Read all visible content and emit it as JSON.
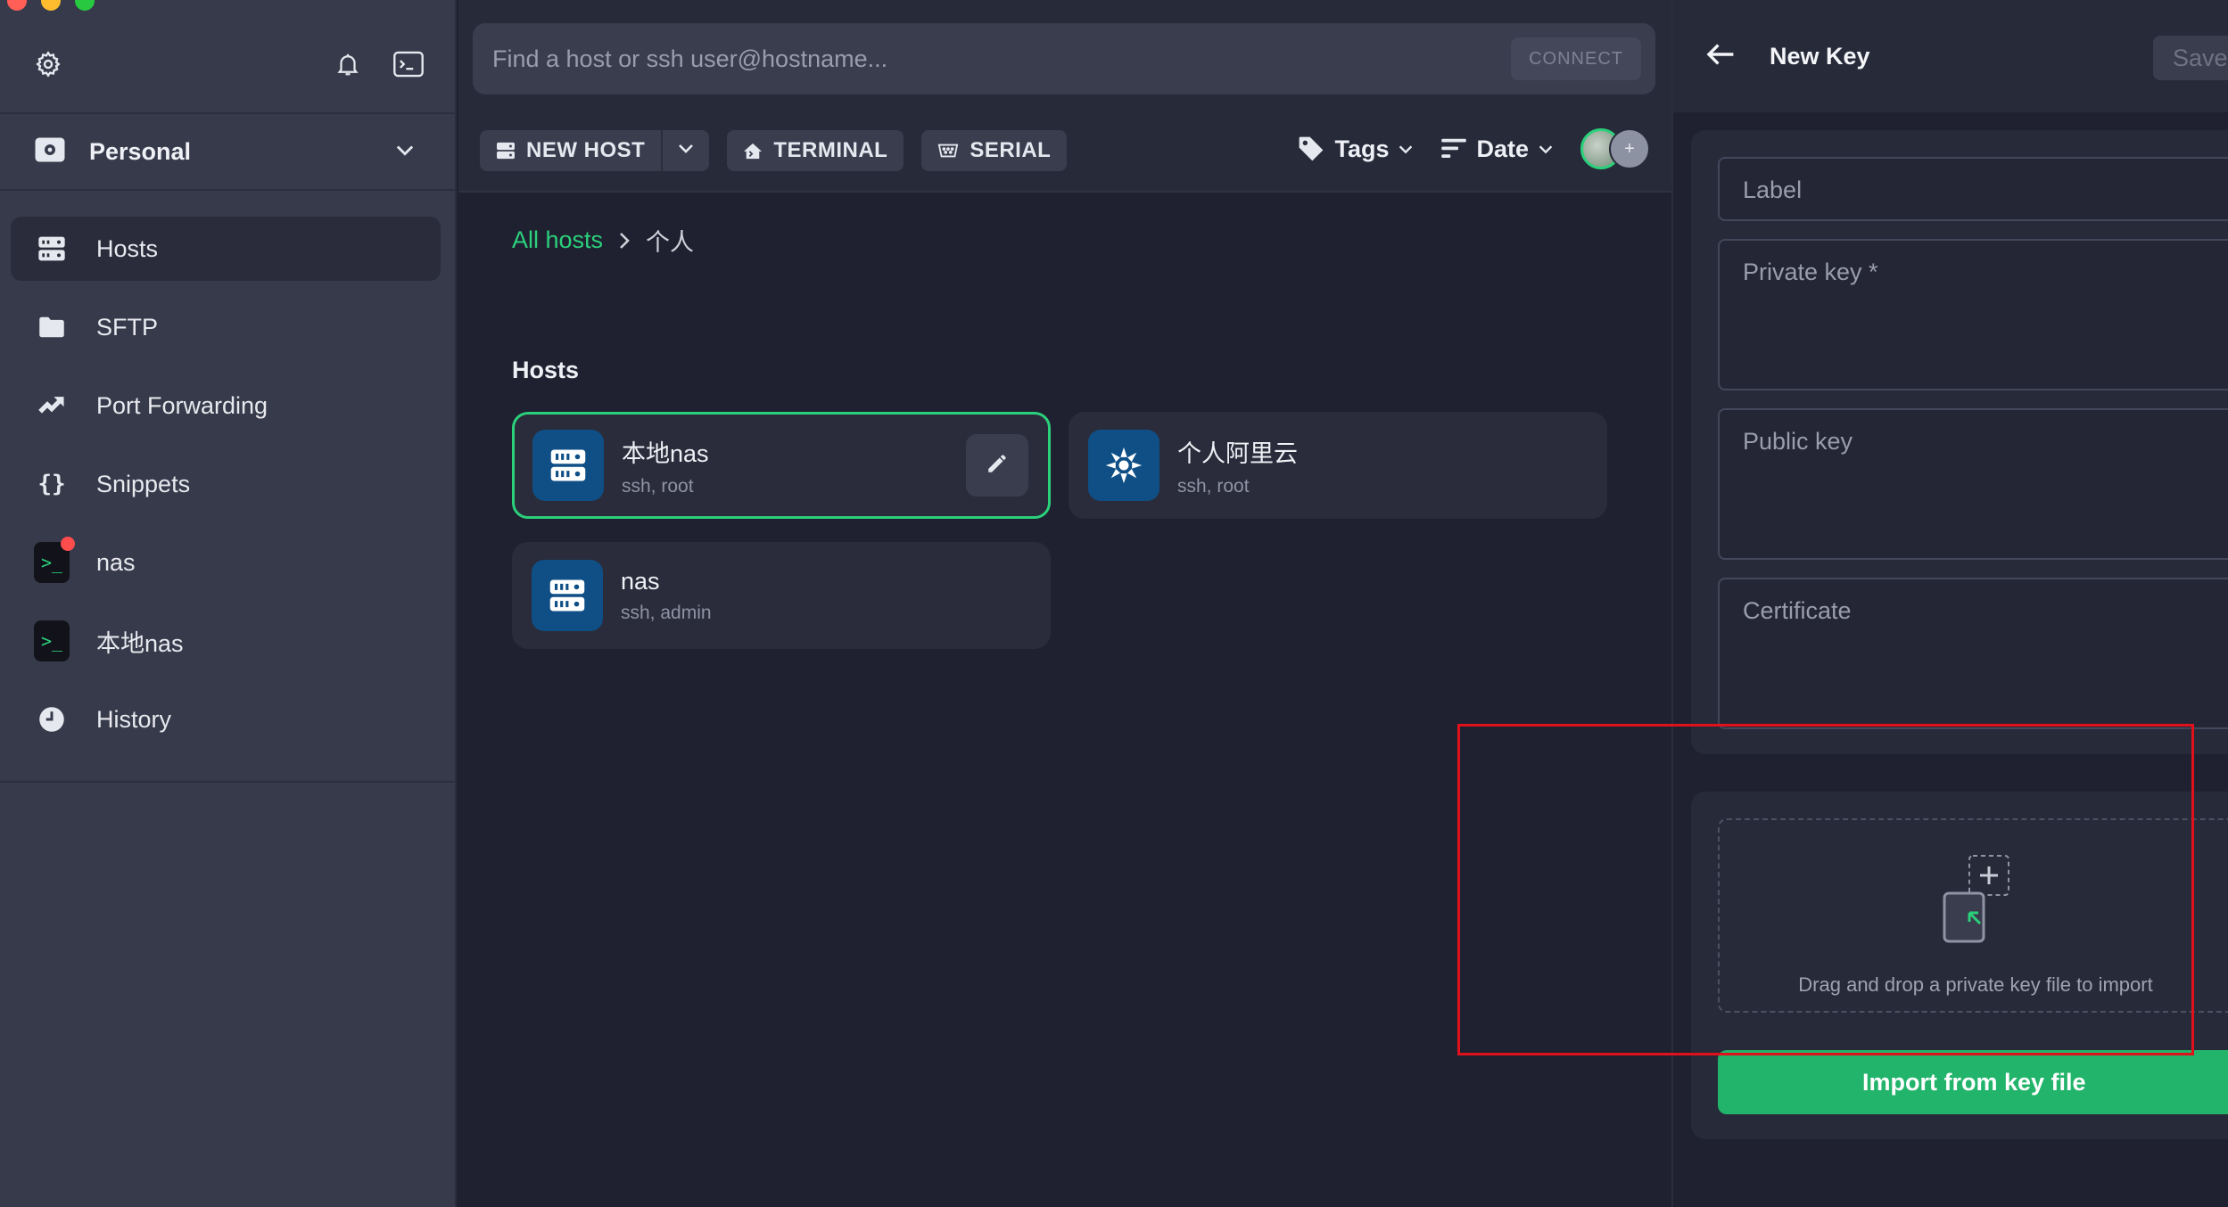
{
  "sidebar": {
    "vault": {
      "label": "Personal"
    },
    "items": [
      {
        "label": "Hosts",
        "icon": "hosts-icon"
      },
      {
        "label": "SFTP",
        "icon": "folder-icon"
      },
      {
        "label": "Port Forwarding",
        "icon": "port-forwarding-icon"
      },
      {
        "label": "Snippets",
        "icon": "braces-icon"
      },
      {
        "label": "nas",
        "icon": "terminal-icon"
      },
      {
        "label": "本地nas",
        "icon": "terminal-icon"
      },
      {
        "label": "History",
        "icon": "clock-icon"
      }
    ]
  },
  "main": {
    "search": {
      "placeholder": "Find a host or ssh user@hostname...",
      "connect_label": "CONNECT"
    },
    "toolbar": {
      "new_host": "NEW HOST",
      "terminal": "TERMINAL",
      "serial": "SERIAL",
      "tags": "Tags",
      "sort": "Date"
    },
    "breadcrumb": {
      "root": "All hosts",
      "current": "个人"
    },
    "section_title": "Hosts",
    "hosts": [
      {
        "name": "本地nas",
        "sub": "ssh, root",
        "icon": "server-icon"
      },
      {
        "name": "个人阿里云",
        "sub": "ssh, root",
        "icon": "aliyun-icon"
      },
      {
        "name": "nas",
        "sub": "ssh, admin",
        "icon": "server-icon"
      }
    ]
  },
  "panel": {
    "title": "New Key",
    "save_label": "Save",
    "fields": {
      "label": "Label",
      "private_key": "Private key *",
      "public_key": "Public key",
      "certificate": "Certificate"
    },
    "dropzone_text": "Drag and drop a private key file to import",
    "import_label": "Import from key file"
  },
  "colors": {
    "accent": "#2bd07b",
    "import_button": "#22b46a",
    "annotation": "#e0111b"
  }
}
